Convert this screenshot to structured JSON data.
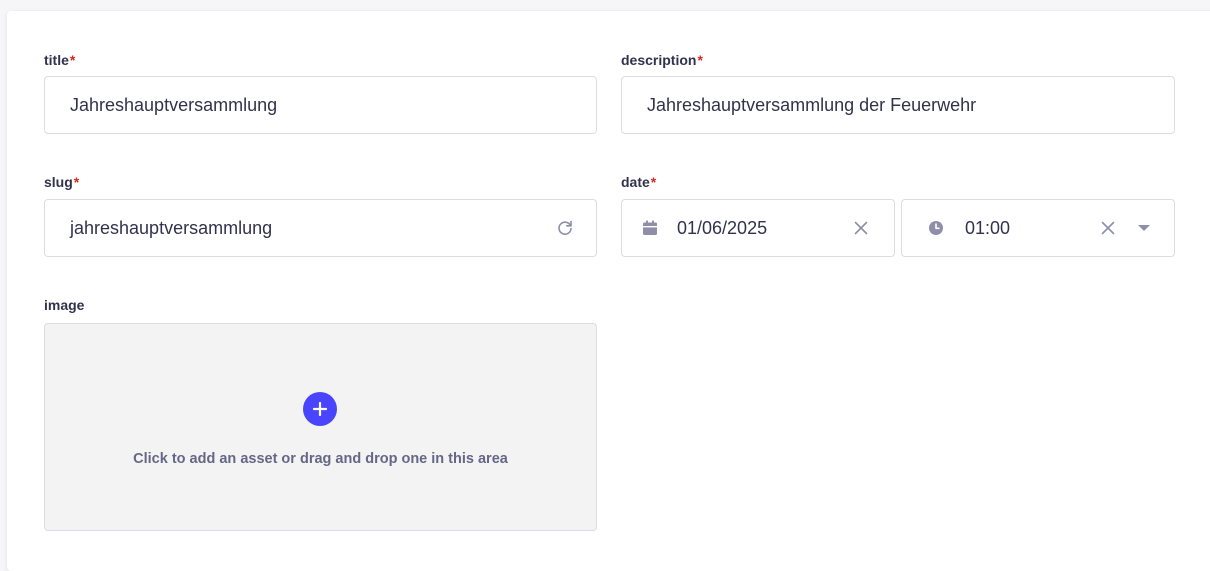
{
  "fields": {
    "title": {
      "label": "title",
      "required_mark": "*",
      "value": "Jahreshauptversammlung"
    },
    "description": {
      "label": "description",
      "required_mark": "*",
      "value": "Jahreshauptversammlung der Feuerwehr"
    },
    "slug": {
      "label": "slug",
      "required_mark": "*",
      "value": "jahreshauptversammlung",
      "regenerate_icon": "refresh-icon"
    },
    "date": {
      "label": "date",
      "required_mark": "*",
      "date_value": "01/06/2025",
      "time_value": "01:00",
      "calendar_icon": "calendar-icon",
      "clock_icon": "clock-icon",
      "clear_icon": "close-icon",
      "dropdown_icon": "caret-down-icon"
    },
    "image": {
      "label": "image",
      "dropzone_text": "Click to add an asset or drag and drop one in this area",
      "add_icon": "plus-icon"
    }
  },
  "colors": {
    "required": "#d02b20",
    "accent": "#4945ff",
    "border": "#dcdce4",
    "icon": "#8e8ea9",
    "dropzone_bg": "#f3f3f3"
  }
}
